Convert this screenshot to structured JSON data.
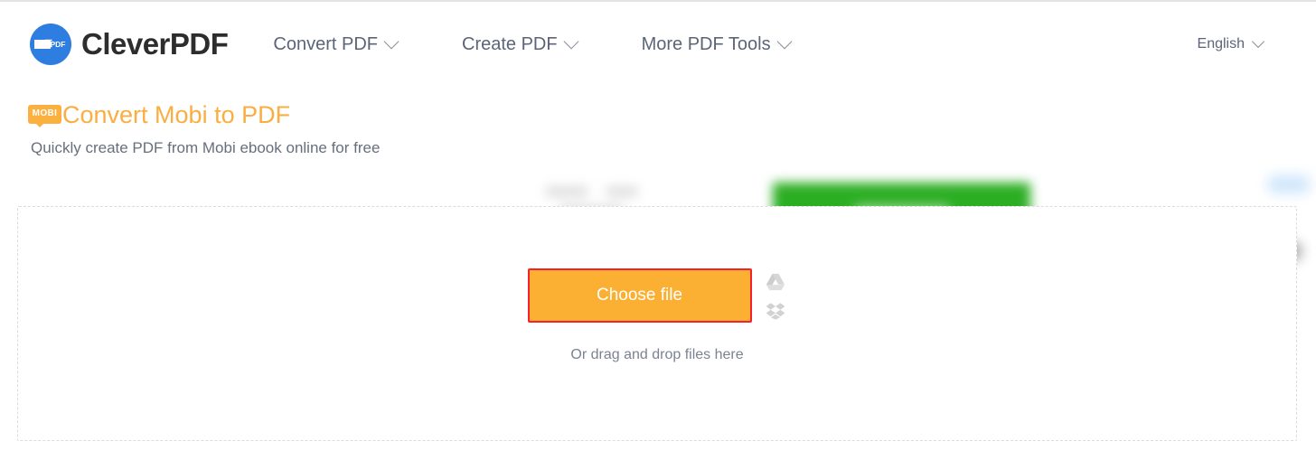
{
  "site": {
    "brand_name": "CleverPDF",
    "logo_icon": "cleverpdf-circle-logo",
    "logo_inner_text": "PDF"
  },
  "header": {
    "nav_items": [
      {
        "label": "Convert PDF",
        "icon": "chevron-down-icon"
      },
      {
        "label": "Create PDF",
        "icon": "chevron-down-icon"
      },
      {
        "label": "More PDF Tools",
        "icon": "chevron-down-icon"
      }
    ],
    "language": {
      "label": "English",
      "icon": "chevron-down-icon"
    }
  },
  "hero": {
    "format_badge": "MOBI",
    "title": "Convert Mobi to PDF",
    "subtitle": "Quickly create PDF from Mobi ebook online for free",
    "title_color": "#faae41",
    "badge_color": "#fbb040"
  },
  "advertisement": {
    "blurred": true,
    "button_color": "#2cae23"
  },
  "dropzone": {
    "choose_file_label": "Choose file",
    "choose_file_color": "#fbb034",
    "highlight_border_color": "#f5222d",
    "drag_hint": "Or drag and drop files here",
    "cloud_sources": [
      {
        "name": "google-drive",
        "icon": "google-drive-icon"
      },
      {
        "name": "dropbox",
        "icon": "dropbox-icon"
      }
    ]
  }
}
